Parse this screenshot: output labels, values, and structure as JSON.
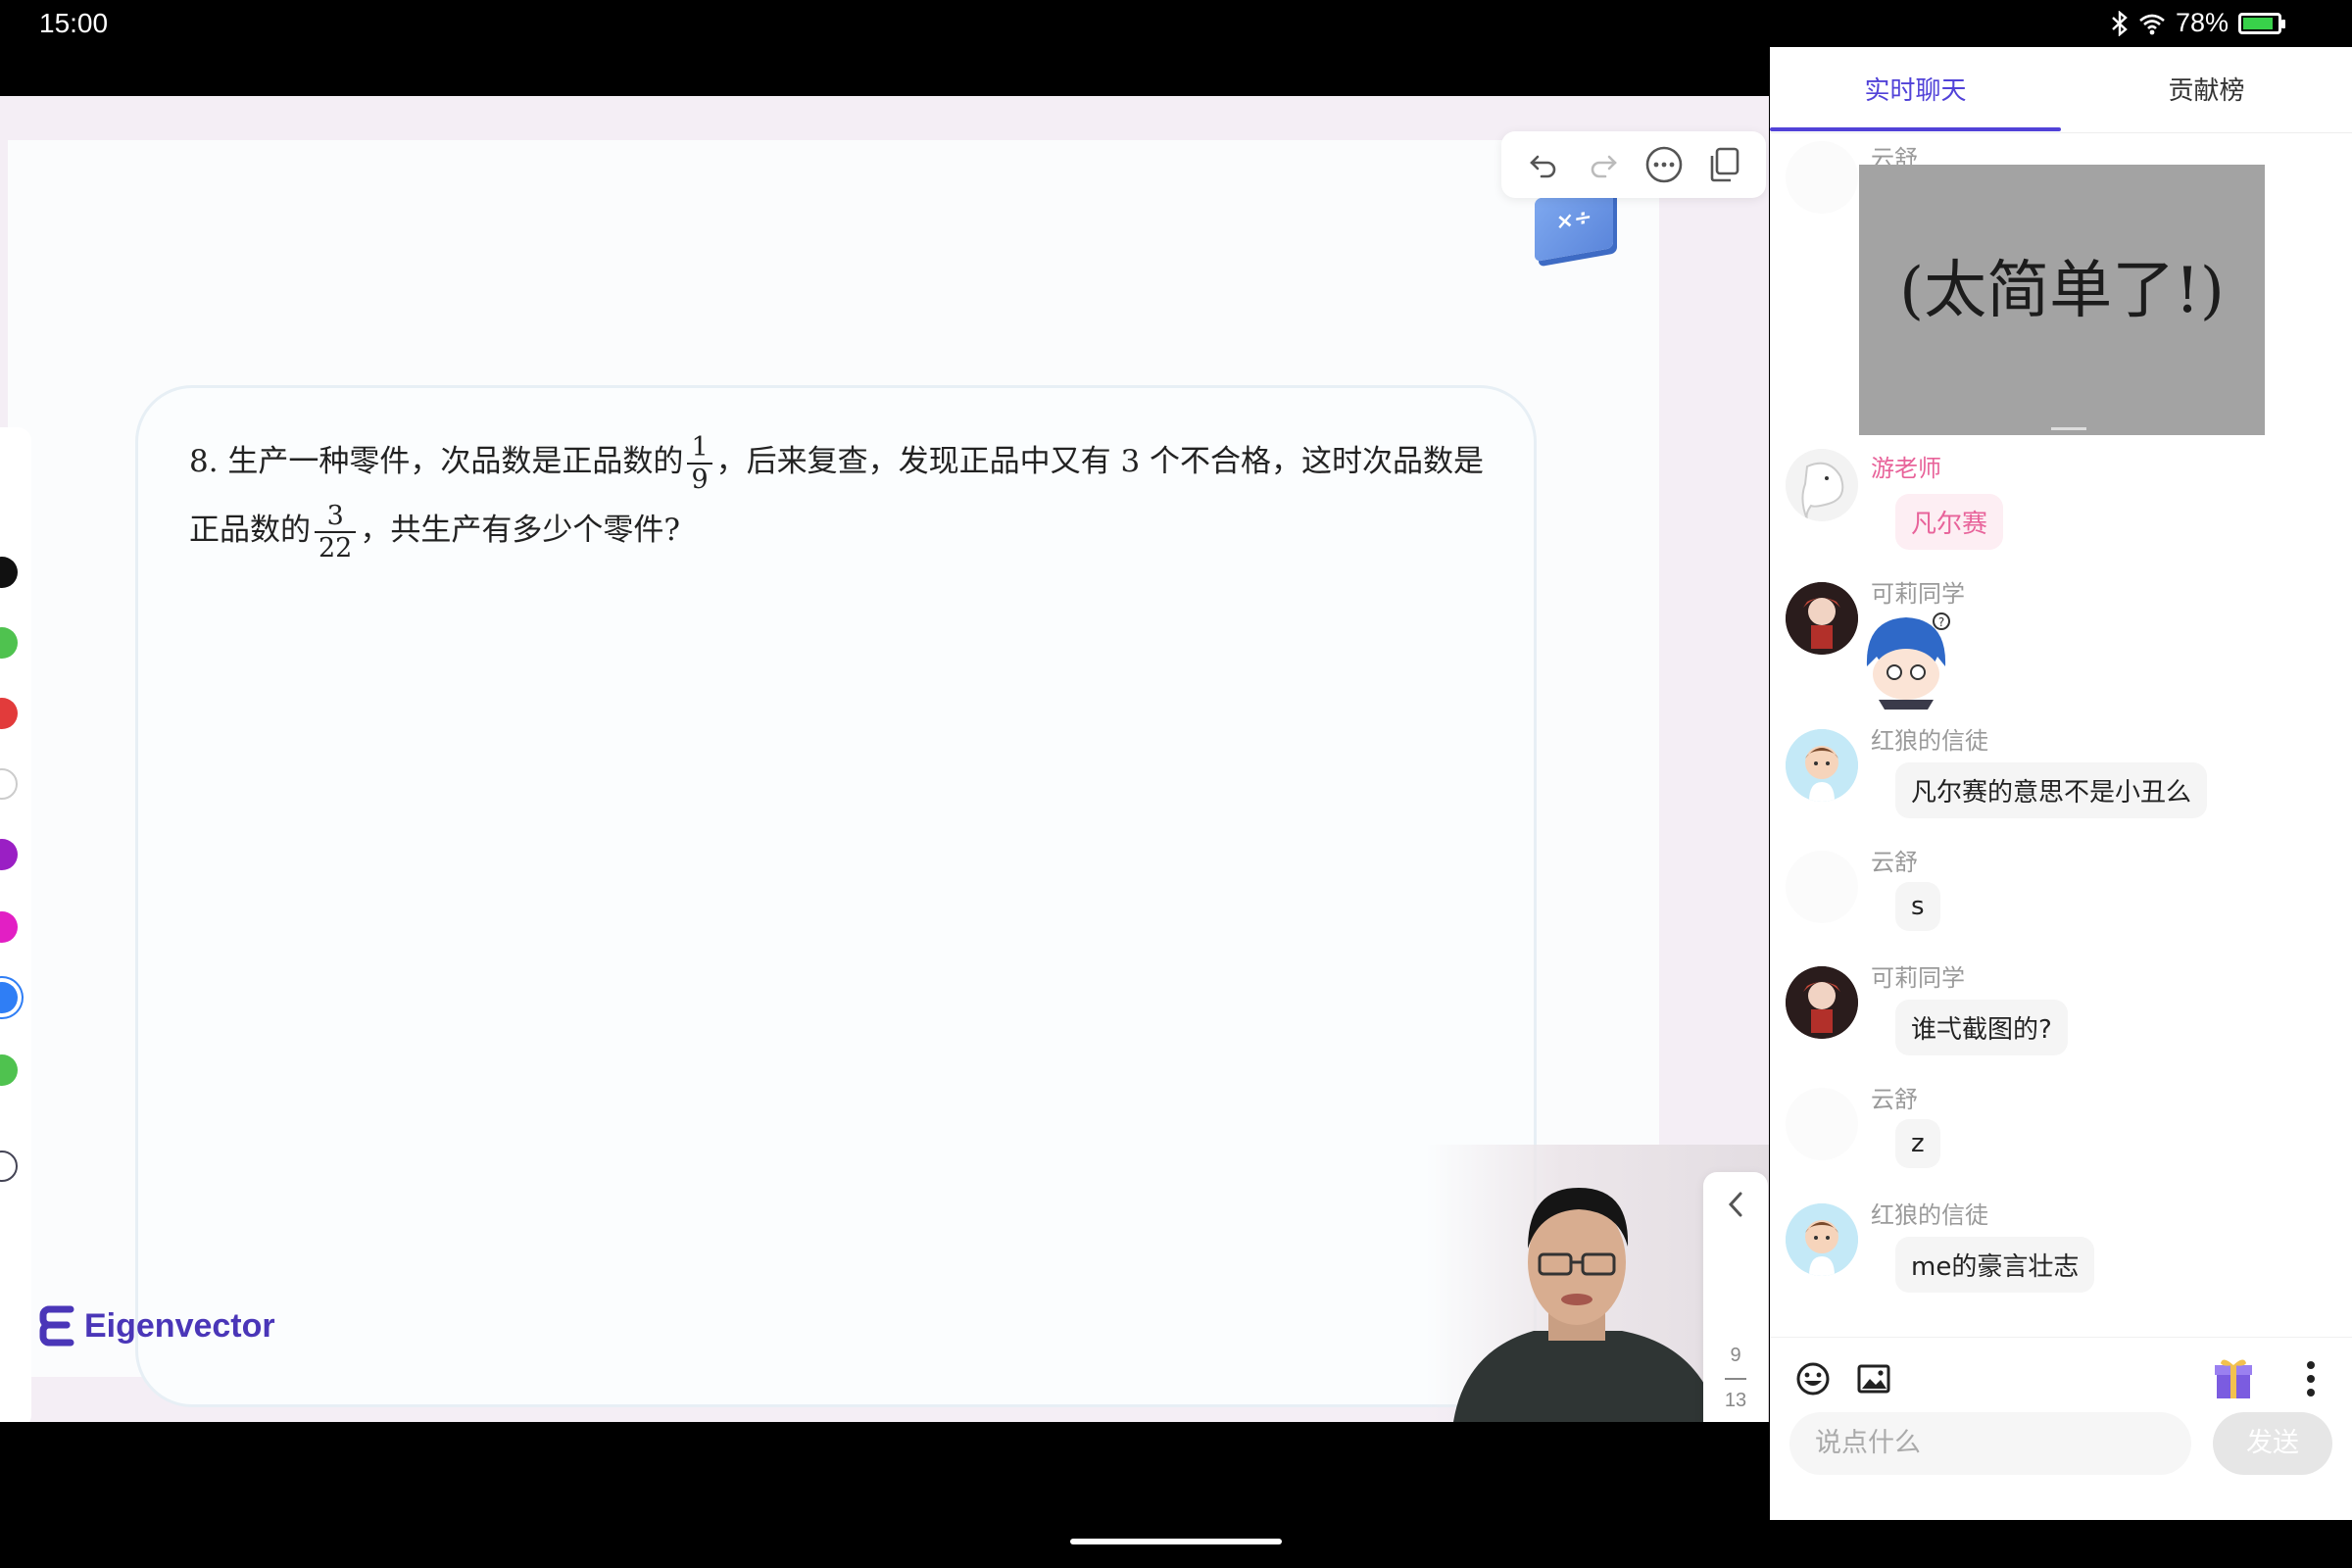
{
  "status_bar": {
    "time": "15:00",
    "battery": "78%"
  },
  "toolbar": {
    "undo_icon": "undo-icon",
    "redo_icon": "redo-icon",
    "more_icon": "more-icon",
    "copy_icon": "copy-icon"
  },
  "question": {
    "part1": "8. 生产一种零件，次品数是正品数的",
    "frac1": {
      "num": "1",
      "den": "9"
    },
    "part2": "，后来复查，发现正品中又有 3 个不合格，这时次品数是正品数的",
    "frac2": {
      "num": "3",
      "den": "22"
    },
    "part3": "，共生产有多少个零件?"
  },
  "palette": {
    "colors": [
      "#111111",
      "#4fc24f",
      "#e23b3b",
      "#ffffff",
      "#9a1fc4",
      "#e21fc4",
      "#2f7ef5",
      "#4fc24f"
    ]
  },
  "logo": {
    "text": "Eigenvector"
  },
  "pager": {
    "current": "9",
    "total": "13"
  },
  "chat": {
    "tabs": [
      {
        "label": "实时聊天"
      },
      {
        "label": "贡献榜"
      }
    ],
    "messages": [
      {
        "name": "云舒",
        "image_text": "(太简单了!)"
      },
      {
        "name": "游老师",
        "text": "凡尔赛"
      },
      {
        "name": "可莉同学"
      },
      {
        "name": "红狼的信徒",
        "text": "凡尔赛的意思不是小丑么"
      },
      {
        "name": "云舒",
        "text": "s"
      },
      {
        "name": "可莉同学",
        "text": "谁弌截图的?"
      },
      {
        "name": "云舒",
        "text": "z"
      },
      {
        "name": "红狼的信徒",
        "text": "me的豪言壮志"
      }
    ],
    "input_placeholder": "说点什么",
    "send_label": "发送"
  },
  "colors": {
    "accent": "#5142d8",
    "teacher_pink": "#e8639a",
    "stage_bg": "#f4eef5"
  }
}
